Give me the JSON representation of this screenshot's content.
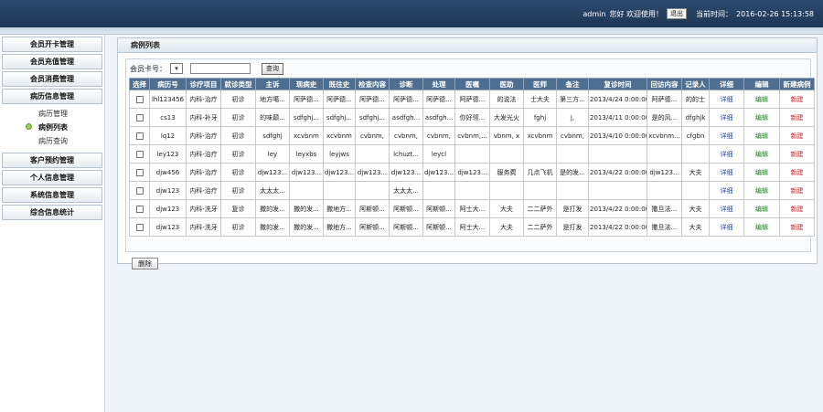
{
  "header": {
    "user": "admin",
    "greeting": "您好 欢迎使用！",
    "logout_label": "退出",
    "time_label": "当前时间：",
    "time_value": "2016-02-26 15:13:58"
  },
  "sidebar": {
    "items": [
      {
        "label": "会员开卡管理"
      },
      {
        "label": "会员充值管理"
      },
      {
        "label": "会员消费管理"
      },
      {
        "label": "病历信息管理"
      }
    ],
    "submenu": [
      {
        "label": "病历管理",
        "active": false
      },
      {
        "label": "病例列表",
        "active": true
      },
      {
        "label": "病历查询",
        "active": false
      }
    ],
    "items_after": [
      {
        "label": "客户预约管理"
      },
      {
        "label": "个人信息管理"
      },
      {
        "label": "系统信息管理"
      },
      {
        "label": "综合信息统计"
      }
    ]
  },
  "panel": {
    "title": "病例列表",
    "search": {
      "label": "会员卡号：",
      "select_value": "▾",
      "input_value": "",
      "button_label": "查询"
    },
    "delete_label": "删除"
  },
  "table": {
    "headers": [
      "选择",
      "病历号",
      "诊疗项目",
      "就诊类型",
      "主诉",
      "现病史",
      "既往史",
      "检查内容",
      "诊断",
      "处理",
      "医嘱",
      "医助",
      "医师",
      "备注",
      "复诊时间",
      "回访内容",
      "记录人",
      "详细",
      "编辑",
      "新建病例"
    ],
    "rows": [
      [
        "",
        "lhl123456",
        "内科-治疗",
        "初诊",
        "地方噶...",
        "阿萨德...",
        "阿萨德...",
        "阿萨德...",
        "阿萨德...",
        "阿萨德...",
        "阿萨德...",
        "的说法",
        "士大夫",
        "第三方...",
        "2013/4/24 0:00:00",
        "阿萨德...",
        "的的士",
        "详细",
        "编辑",
        "新建"
      ],
      [
        "",
        "cs13",
        "内科-补牙",
        "初诊",
        "的味颠...",
        "sdfghj...",
        "sdfghj...",
        "sdfghj...",
        "asdfgh...",
        "asdfgh...",
        "你好领...",
        "大发光火",
        "fghj",
        "j,",
        "2013/4/11 0:00:00",
        "是的风...",
        "dfghjk",
        "详细",
        "编辑",
        "新建"
      ],
      [
        "",
        "lq12",
        "内科-治疗",
        "初诊",
        "sdfghj",
        "xcvbnm",
        "xcvbnm",
        "cvbnm,",
        "cvbnm,",
        "cvbnm,",
        "cvbnm,...",
        "vbnm, x",
        "xcvbnm",
        "cvbnm,",
        "2013/4/10 0:00:00",
        "xcvbnm...",
        "cfgbn",
        "详细",
        "编辑",
        "新建"
      ],
      [
        "",
        "ley123",
        "内科-治疗",
        "初诊",
        "ley",
        "leyxbs",
        "leyjws",
        "",
        "lchuzt...",
        "leycl",
        "",
        "",
        "",
        "",
        "",
        "",
        "",
        "详细",
        "编辑",
        "新建"
      ],
      [
        "",
        "djw456",
        "内科-治疗",
        "初诊",
        "djw123...",
        "djw123...",
        "djw123...",
        "djw123...",
        "djw123...",
        "djw123...",
        "djw123...",
        "服务费",
        "几点飞机",
        "是的发...",
        "2013/4/22 0:00:00",
        "djw123...",
        "大夫",
        "详细",
        "编辑",
        "新建"
      ],
      [
        "",
        "djw123",
        "内科-治疗",
        "初诊",
        "太太太...",
        "",
        "",
        "",
        "太太太...",
        "",
        "",
        "",
        "",
        "",
        "",
        "",
        "",
        "详细",
        "编辑",
        "新建"
      ],
      [
        "",
        "djw123",
        "内科-洗牙",
        "复诊",
        "撒的发...",
        "撒的发...",
        "撒地方...",
        "阿斯顿...",
        "阿斯顿...",
        "阿斯顿...",
        "阿士大...",
        "大夫",
        "二二萨外",
        "是打发",
        "2013/4/22 0:00:00",
        "撒旦法...",
        "大夫",
        "详细",
        "编辑",
        "新建"
      ],
      [
        "",
        "djw123",
        "内科-洗牙",
        "初诊",
        "撒的发...",
        "撒的发...",
        "撒地方...",
        "阿斯顿...",
        "阿斯顿...",
        "阿斯顿...",
        "阿士大...",
        "大夫",
        "二二萨外",
        "是打发",
        "2013/4/22 0:00:00",
        "撒旦法...",
        "大夫",
        "详细",
        "编辑",
        "新建"
      ]
    ]
  },
  "colors": {
    "header_bg": "#1e3654",
    "table_header_bg": "#4e6f8f",
    "detail_link": "#1a3ccf",
    "edit_link": "#1a7a1a",
    "new_link": "#d41a1a"
  }
}
